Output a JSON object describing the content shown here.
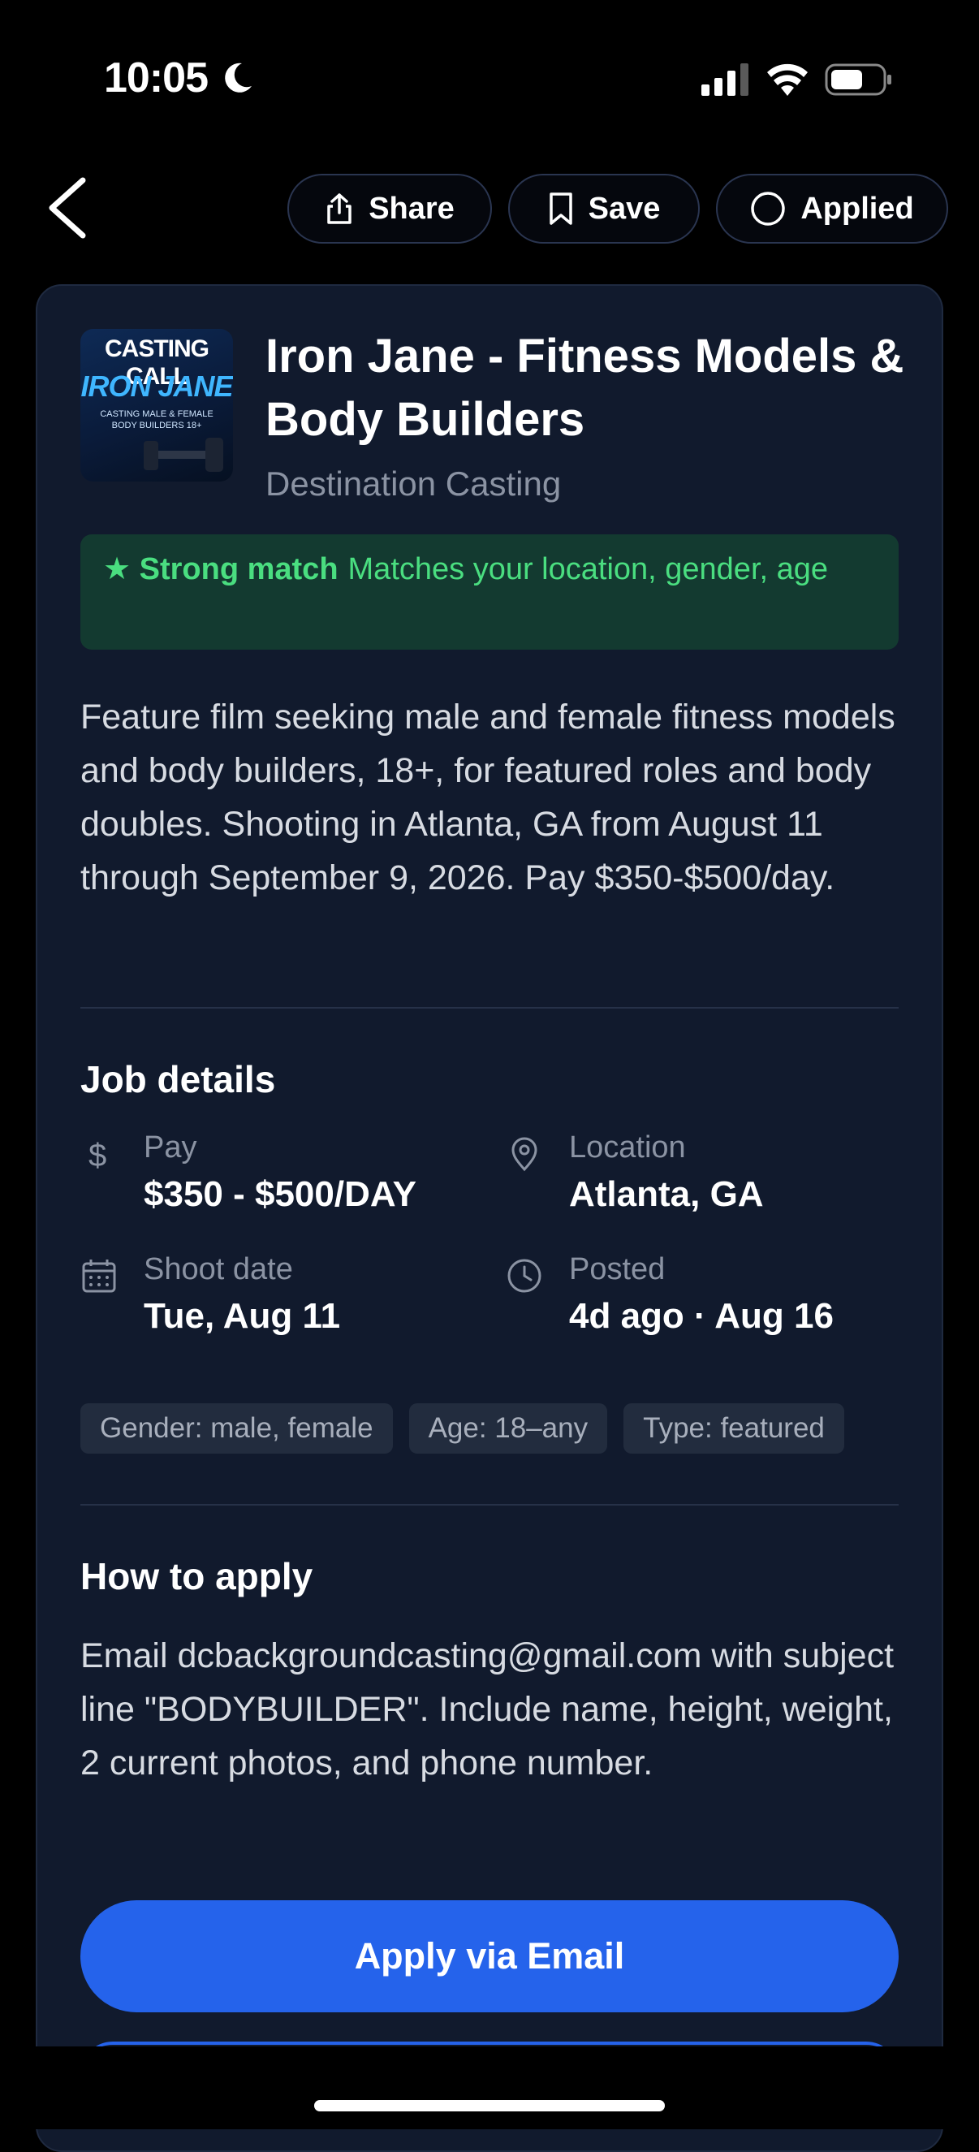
{
  "status_bar": {
    "time": "10:05"
  },
  "nav": {
    "share_label": "Share",
    "save_label": "Save",
    "applied_label": "Applied"
  },
  "job": {
    "poster": {
      "line1": "CASTING CALL",
      "line2": "IRON JANE",
      "line3": "CASTING MALE & FEMALE BODY BUILDERS 18+"
    },
    "title": "Iron Jane - Fitness Models & Body Builders",
    "studio": "Destination Casting",
    "match": {
      "strength": "★ Strong match",
      "reason": "Matches your location, gender, age"
    },
    "description": "Feature film seeking male and female fitness models and body builders, 18+, for featured roles and body doubles. Shooting in Atlanta, GA from August 11 through September 9, 2026. Pay $350-$500/day."
  },
  "details": {
    "heading": "Job details",
    "pay": {
      "label": "Pay",
      "value": "$350 - $500/DAY"
    },
    "location": {
      "label": "Location",
      "value": "Atlanta, GA"
    },
    "shoot_date": {
      "label": "Shoot date",
      "value": "Tue, Aug 11"
    },
    "posted": {
      "label": "Posted",
      "value": "4d ago · Aug 16"
    },
    "tags": [
      "Gender: male, female",
      "Age: 18–any",
      "Type: featured"
    ]
  },
  "how_to_apply": {
    "heading": "How to apply",
    "text": "Email dcbackgroundcasting@gmail.com with subject line \"BODYBUILDER\". Include name, height, weight, 2 current photos, and phone number.",
    "button_label": "Apply via Email"
  },
  "colors": {
    "background": "#000000",
    "card": "#111a2d",
    "accent": "#2563eb",
    "match_bg": "#133a30",
    "match_text": "#4ade80"
  }
}
